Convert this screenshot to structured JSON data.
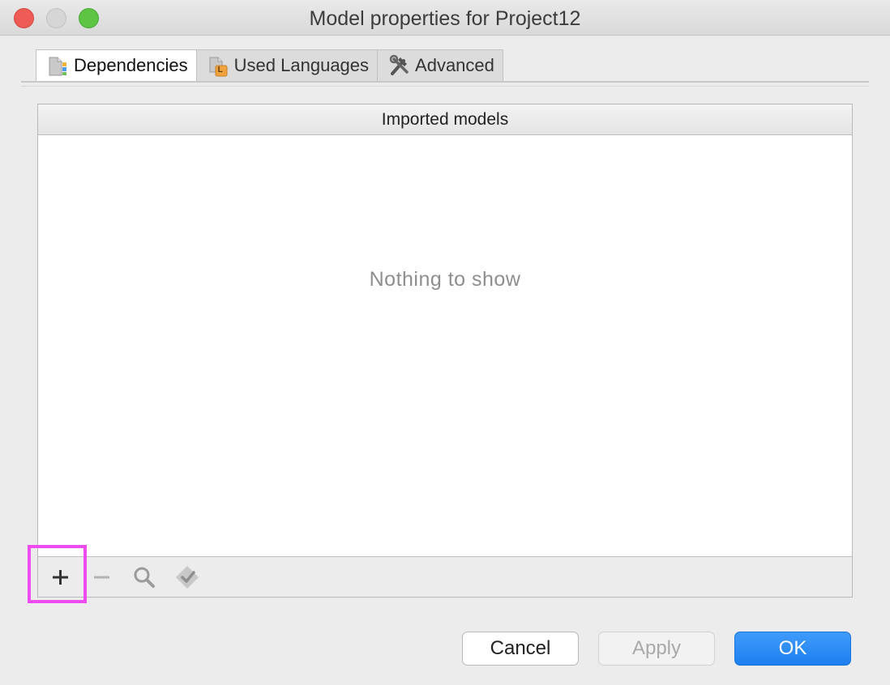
{
  "window": {
    "title": "Model properties for Project12"
  },
  "tabs": [
    {
      "label": "Dependencies",
      "icon": "dependencies-icon",
      "active": true
    },
    {
      "label": "Used Languages",
      "icon": "used-languages-icon",
      "active": false
    },
    {
      "label": "Advanced",
      "icon": "wrench-hammer-icon",
      "active": false
    }
  ],
  "tab_badge": "L",
  "table": {
    "column_header": "Imported models",
    "empty_text": "Nothing to show"
  },
  "toolbar": {
    "add": "add-icon",
    "remove": "remove-icon",
    "search": "search-icon",
    "check": "check-models-icon"
  },
  "buttons": {
    "cancel": "Cancel",
    "apply": "Apply",
    "ok": "OK"
  },
  "colors": {
    "accent": "#1e7ff0",
    "highlight": "#ee4cf0",
    "close": "#ee5c55",
    "maximize": "#5ec444"
  }
}
